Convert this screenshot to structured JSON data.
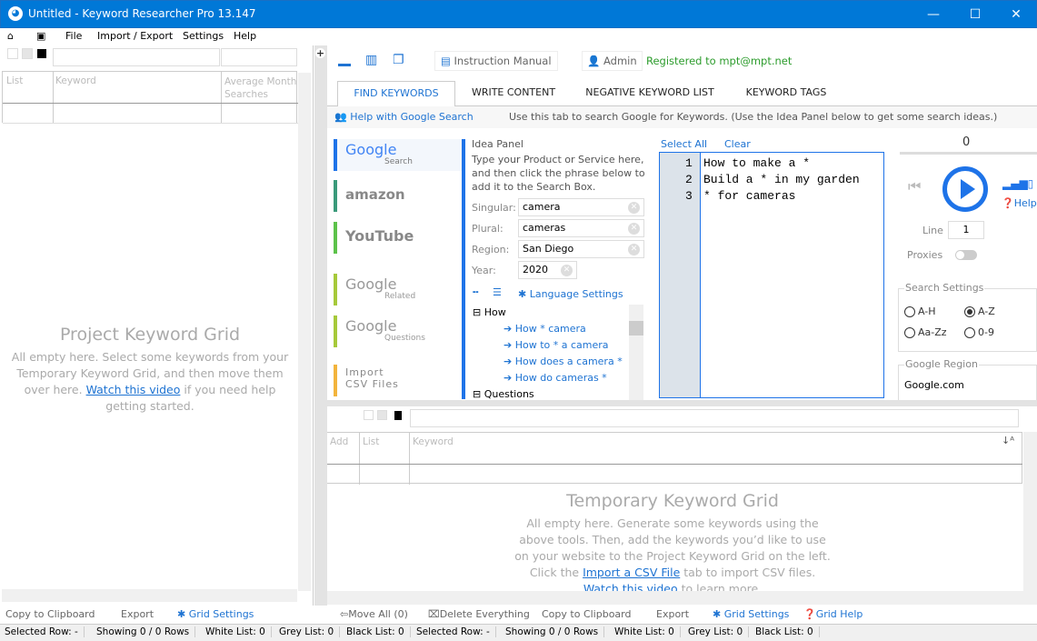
{
  "window": {
    "title": "Untitled - Keyword Researcher Pro 13.147",
    "app_icon": "cat-logo-icon",
    "minimize": "—",
    "maximize": "☐",
    "close": "✕"
  },
  "menu": {
    "items": [
      "File",
      "Import / Export",
      "Settings",
      "Help"
    ],
    "home_icon": "home-icon",
    "save_icon": "save-icon"
  },
  "project_grid": {
    "columns": [
      "List",
      "Keyword",
      "Average Month Searches"
    ],
    "title": "Project Keyword Grid",
    "text_before": "All empty here. Select some keywords from your Temporary Keyword Grid, and then move them over here.",
    "link": "Watch this video",
    "text_after": " if you need help getting started."
  },
  "left_toolbar": {
    "copy": "Copy to Clipboard",
    "export": "Export",
    "grid_settings": "Grid Settings"
  },
  "toolbar": {
    "instruction_manual": "Instruction Manual",
    "admin": "Admin",
    "registered": "Registered to mpt@mpt.net"
  },
  "tabs": [
    {
      "label": "FIND KEYWORDS",
      "active": true
    },
    {
      "label": "WRITE CONTENT"
    },
    {
      "label": "NEGATIVE KEYWORD LIST"
    },
    {
      "label": "KEYWORD TAGS"
    }
  ],
  "help_bar": {
    "link": "Help with Google Search",
    "text": "Use this tab to search Google for Keywords. (Use the Idea Panel below to get some search ideas.)"
  },
  "sources": [
    {
      "name": "Google",
      "sub": "Search",
      "color": "#1e73e8"
    },
    {
      "name": "amazon",
      "sub": "",
      "color": "#3a9a7a"
    },
    {
      "name": "YouTube",
      "sub": "",
      "color": "#5cc24a"
    },
    {
      "name": "Google",
      "sub": "Related",
      "color": "#a6c93a"
    },
    {
      "name": "Google",
      "sub": "Questions",
      "color": "#a6c93a"
    },
    {
      "name": "Import CSV Files",
      "sub": "",
      "color": "#f2b43c"
    }
  ],
  "idea_panel": {
    "title": "Idea Panel",
    "desc": "Type your Product or Service here, and then click the phrase below to add it to the Search Box.",
    "singular_label": "Singular:",
    "singular": "camera",
    "plural_label": "Plural:",
    "plural": "cameras",
    "region_label": "Region:",
    "region": "San Diego",
    "year_label": "Year:",
    "year": "2020",
    "language_settings": "Language Settings",
    "tree": {
      "group": "How",
      "items": [
        "How * camera",
        "How to * a camera",
        "How does a camera *",
        "How do cameras *"
      ],
      "next_group": "Questions"
    }
  },
  "search_box": {
    "select_all": "Select All",
    "clear": "Clear",
    "lines": [
      "How to make a *",
      "Build a * in my garden",
      "* for cameras"
    ]
  },
  "controls": {
    "progress": "0",
    "help": "Help",
    "line_label": "Line",
    "line": "1",
    "proxies_label": "Proxies",
    "proxies_on": false,
    "search_settings_label": "Search Settings",
    "options": [
      {
        "label": "A-H",
        "checked": false
      },
      {
        "label": "A-Z",
        "checked": true
      },
      {
        "label": "Aa-Zz",
        "checked": false
      },
      {
        "label": "0-9",
        "checked": false
      }
    ],
    "google_region_label": "Google Region",
    "google_region": "Google.com"
  },
  "temp_grid": {
    "columns": [
      "Add",
      "List",
      "Keyword"
    ],
    "title": "Temporary Keyword Grid",
    "text_before": "All empty here. Generate some keywords using the above tools. Then, add the keywords you’d like to use on your website to the Project Keyword Grid on the left. Click the ",
    "link": "Import a CSV File",
    "text_after": " tab to import CSV files.",
    "link2": "Watch this video",
    "text_after2": " to learn more."
  },
  "right_toolbar": {
    "move_all": "Move All (0)",
    "delete": "Delete Everything",
    "copy": "Copy to Clipboard",
    "export": "Export",
    "grid_settings": "Grid Settings",
    "grid_help": "Grid Help"
  },
  "status": [
    "Selected Row: -",
    "Showing 0 / 0 Rows",
    "White List: 0",
    "Grey List: 0",
    "Black List: 0",
    "Selected Row: -",
    "Showing 0 / 0 Rows",
    "White List: 0",
    "Grey List: 0",
    "Black List: 0"
  ]
}
